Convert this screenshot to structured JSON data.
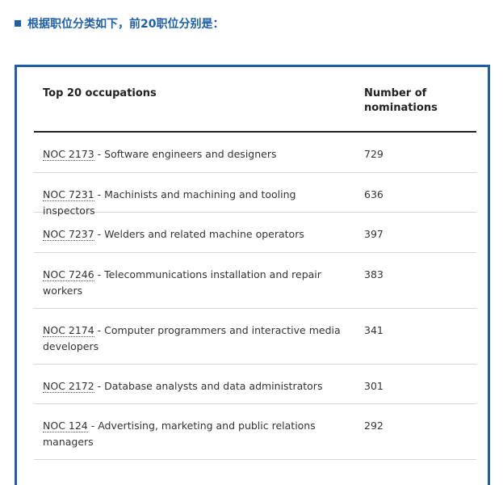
{
  "heading": {
    "text": "根据职位分类如下，前20职位分别是："
  },
  "table": {
    "headers": {
      "occupation": "Top 20 occupations",
      "nominations": "Number of nominations"
    },
    "rows": [
      {
        "code": "NOC 2173",
        "title": " - Software engineers and designers",
        "count": "729"
      },
      {
        "code": "NOC 7231",
        "title": " - Machinists and machining and tooling inspectors",
        "count": "636"
      },
      {
        "code": "NOC 7237",
        "title": " - Welders and related machine operators",
        "count": "397"
      },
      {
        "code": "NOC 7246",
        "title": " - Telecommunications installation and repair workers",
        "count": "383"
      },
      {
        "code": "NOC 2174",
        "title": " - Computer programmers and interactive media developers",
        "count": "341"
      },
      {
        "code": "NOC 2172",
        "title": " - Database analysts and data administrators",
        "count": "301"
      },
      {
        "code": "NOC 124",
        "title": " - Advertising, marketing and public relations managers",
        "count": "292"
      }
    ]
  }
}
